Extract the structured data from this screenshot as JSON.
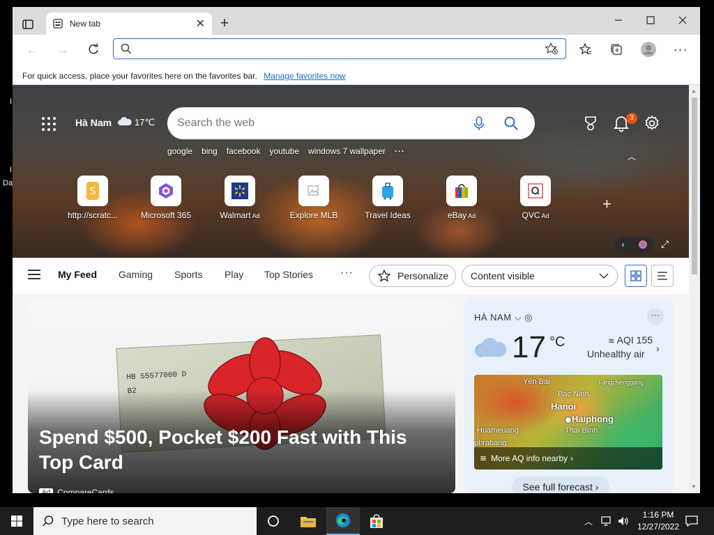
{
  "desktop": {
    "fragments": [
      "I",
      "I",
      "Da"
    ]
  },
  "browser": {
    "tab_title": "New tab",
    "address_value": "",
    "favorites_bar": {
      "message": "For quick access, place your favorites here on the favorites bar.",
      "link": "Manage favorites now"
    }
  },
  "newtab": {
    "location": "Hà Nam",
    "temp_small": "17℃",
    "search_placeholder": "Search the web",
    "notification_count": "3",
    "quick_searches": [
      "google",
      "bing",
      "facebook",
      "youtube",
      "windows 7 wallpaper"
    ],
    "tiles": [
      {
        "label": "http://scratc...",
        "ad": ""
      },
      {
        "label": "Microsoft 365",
        "ad": ""
      },
      {
        "label": "Walmart",
        "ad": "Ad"
      },
      {
        "label": "Explore MLB",
        "ad": ""
      },
      {
        "label": "Travel Ideas",
        "ad": ""
      },
      {
        "label": "eBay",
        "ad": "Ad"
      },
      {
        "label": "QVC",
        "ad": "Ad"
      }
    ]
  },
  "feed": {
    "tabs": [
      "My Feed",
      "Gaming",
      "Sports",
      "Play",
      "Top Stories"
    ],
    "personalize": "Personalize",
    "content_visibility": "Content visible",
    "main_card": {
      "headline": "Spend $500, Pocket $200 Fast with This Top Card",
      "ad_label": "Ad",
      "source": "CompareCards",
      "serial": "HB 55577000 D",
      "serial2": "B2"
    },
    "weather": {
      "location": "HÀ NAM",
      "temperature": "17",
      "unit": "°C",
      "aqi": "AQI 155",
      "aqi_status": "Unhealthy air",
      "map_labels": {
        "yen_bai": "Yên Bái",
        "bac_ninh": "Bac Ninh",
        "fangcheng": "Fangchenggang",
        "hanoi": "Hanoi",
        "haiphong": "Haiphong",
        "huameuang": "Huameuang",
        "thai_binh": "Thái Bình",
        "phrabang": "phrabang"
      },
      "aq_link": "More AQ info nearby",
      "forecast_button": "See full forecast"
    }
  },
  "taskbar": {
    "search_placeholder": "Type here to search",
    "time": "1:16 PM",
    "date": "12/27/2022"
  },
  "colors": {
    "accent": "#2f6cc7",
    "badge": "#e4541b",
    "taskbar": "#1e1e1e"
  }
}
